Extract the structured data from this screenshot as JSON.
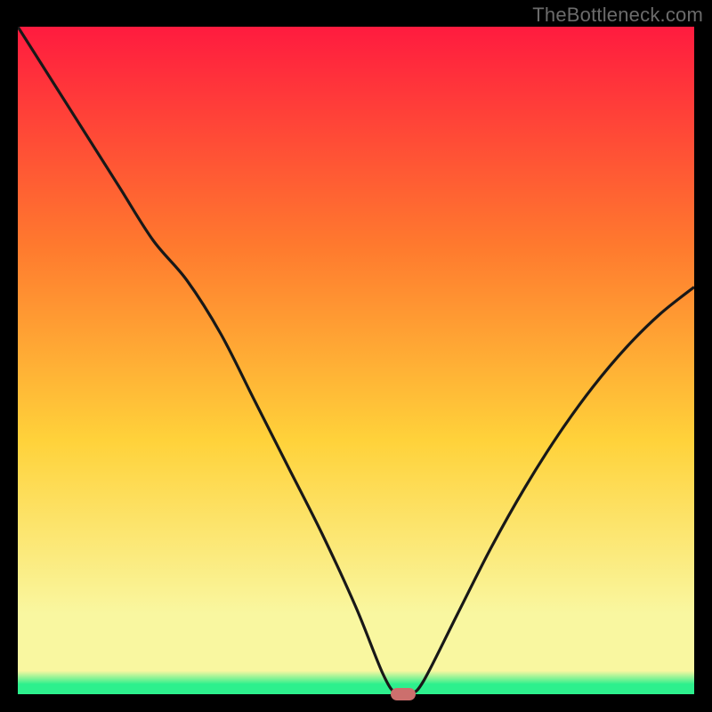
{
  "watermark": "TheBottleneck.com",
  "colors": {
    "top": "#ff1b3f",
    "mid1": "#ff7a2e",
    "mid2": "#ffd23a",
    "pale": "#f9f7a0",
    "green": "#2df08d",
    "line": "#181818",
    "marker": "#cc6f6d",
    "frame": "#000000"
  },
  "chart_data": {
    "type": "line",
    "title": "",
    "xlabel": "",
    "ylabel": "",
    "xlim": [
      0,
      100
    ],
    "ylim": [
      0,
      100
    ],
    "x": [
      0,
      5,
      10,
      15,
      20,
      25,
      30,
      35,
      40,
      45,
      50,
      54,
      56,
      58,
      60,
      65,
      70,
      75,
      80,
      85,
      90,
      95,
      100
    ],
    "values": [
      100,
      92,
      84,
      76,
      68,
      62,
      54,
      44,
      34,
      24,
      13,
      3,
      0,
      0,
      2,
      12,
      22,
      31,
      39,
      46,
      52,
      57,
      61
    ],
    "marker": {
      "x": 57,
      "y": 0
    },
    "gradient_stops": [
      {
        "t": 0.0,
        "c": "#ff1b3f"
      },
      {
        "t": 0.33,
        "c": "#ff7a2e"
      },
      {
        "t": 0.62,
        "c": "#ffd23a"
      },
      {
        "t": 0.88,
        "c": "#f9f7a0"
      },
      {
        "t": 0.965,
        "c": "#f9f7a0"
      },
      {
        "t": 0.985,
        "c": "#2df08d"
      },
      {
        "t": 1.0,
        "c": "#2df08d"
      }
    ]
  }
}
